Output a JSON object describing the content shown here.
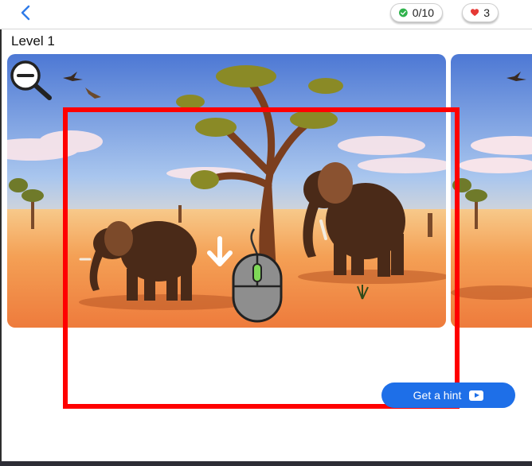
{
  "header": {
    "back_icon": "chevron-left-icon",
    "score": {
      "icon": "check-circle-icon",
      "value": "0/10",
      "color": "#2fb24c"
    },
    "lives": {
      "icon": "heart-icon",
      "value": "3",
      "color": "#e53935"
    }
  },
  "level": {
    "title": "Level 1"
  },
  "scene": {
    "zoom_icon": "zoom-out-icon",
    "cursor_icon": "mouse-icon",
    "arrow_icon": "arrow-down-icon",
    "highlight_color": "#ff0000"
  },
  "hint": {
    "label": "Get a hint",
    "icon": "video-play-icon",
    "color": "#1e6fe8"
  }
}
